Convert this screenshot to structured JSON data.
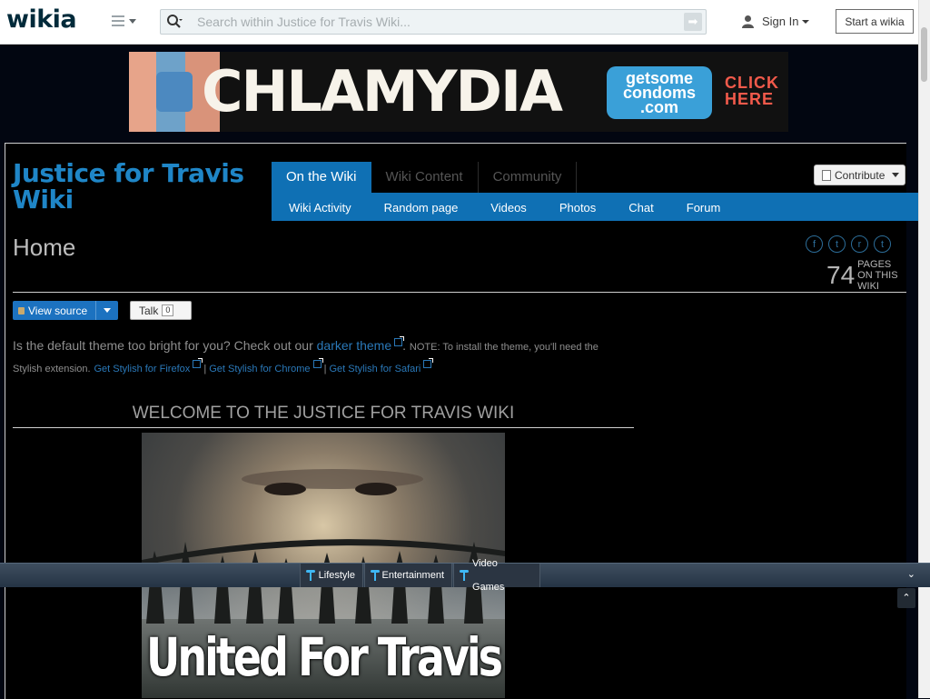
{
  "globalnav": {
    "logo": "wikia",
    "search_placeholder": "Search within Justice for Travis Wiki...",
    "sign_in": "Sign In",
    "start_wikia": "Start a wikia"
  },
  "ad": {
    "headline": "CHLAMYDIA",
    "brand_line1": "getsome",
    "brand_line2": "condoms",
    "brand_line3": ".com",
    "cta_line1": "CLICK",
    "cta_line2": "HERE"
  },
  "wiki": {
    "title": "Justice for Travis Wiki",
    "tabs": [
      {
        "label": "On the Wiki",
        "active": true
      },
      {
        "label": "Wiki Content",
        "active": false
      },
      {
        "label": "Community",
        "active": false
      }
    ],
    "subnav": [
      "Wiki Activity",
      "Random page",
      "Videos",
      "Photos",
      "Chat",
      "Forum"
    ],
    "contribute": "Contribute"
  },
  "page": {
    "title": "Home",
    "share_icons": [
      "facebook-icon",
      "twitter-icon",
      "reddit-icon",
      "tumblr-icon"
    ],
    "share_glyphs": [
      "f",
      "t",
      "r",
      "t"
    ],
    "page_count": "74",
    "page_count_label": "PAGES ON THIS WIKI",
    "view_source": "View source",
    "talk": "Talk",
    "talk_count": "0"
  },
  "content": {
    "intro": "Is the default theme too bright for you? Check out our",
    "darker_theme_link": "darker theme",
    "note": "NOTE: To install the theme, you'll need the Stylish extension.",
    "firefox_link": "Get Stylish for Firefox",
    "chrome_link": "Get Stylish for Chrome",
    "safari_link": "Get Stylish for Safari",
    "separator": "|",
    "welcome_heading": "WELCOME TO THE JUSTICE FOR TRAVIS WIKI",
    "image_caption": "United For Travis"
  },
  "fanbar": {
    "items": [
      "Lifestyle",
      "Entertainment",
      "Video Games"
    ]
  },
  "colors": {
    "accent": "#0f70b4",
    "title_blue": "#1f86c7",
    "link": "#2a78b8",
    "background": "#000000"
  }
}
